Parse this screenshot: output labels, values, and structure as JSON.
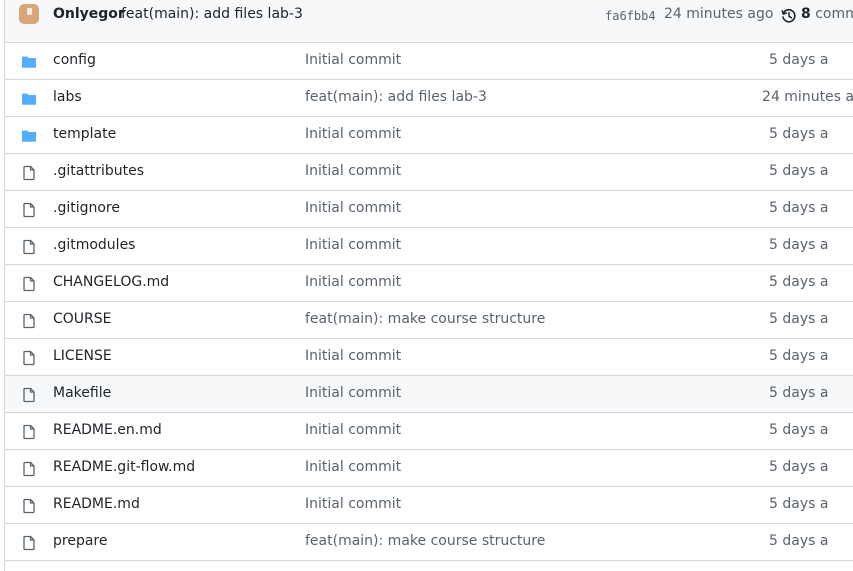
{
  "latest_commit": {
    "author": "Onlyegor",
    "message": "feat(main): add files lab-3",
    "sha": "fa6fbb4",
    "time": "24 minutes ago",
    "commits_count": "8",
    "commits_label": "comm"
  },
  "files": [
    {
      "name": "config",
      "type": "folder",
      "message": "Initial commit",
      "time": "5 days a"
    },
    {
      "name": "labs",
      "type": "folder",
      "message": "feat(main): add files lab-3",
      "time": "24 minutes a"
    },
    {
      "name": "template",
      "type": "folder",
      "message": "Initial commit",
      "time": "5 days a"
    },
    {
      "name": ".gitattributes",
      "type": "file",
      "message": "Initial commit",
      "time": "5 days a"
    },
    {
      "name": ".gitignore",
      "type": "file",
      "message": "Initial commit",
      "time": "5 days a"
    },
    {
      "name": ".gitmodules",
      "type": "file",
      "message": "Initial commit",
      "time": "5 days a"
    },
    {
      "name": "CHANGELOG.md",
      "type": "file",
      "message": "Initial commit",
      "time": "5 days a"
    },
    {
      "name": "COURSE",
      "type": "file",
      "message": "feat(main): make course structure",
      "time": "5 days a"
    },
    {
      "name": "LICENSE",
      "type": "file",
      "message": "Initial commit",
      "time": "5 days a"
    },
    {
      "name": "Makefile",
      "type": "file",
      "message": "Initial commit",
      "time": "5 days a"
    },
    {
      "name": "README.en.md",
      "type": "file",
      "message": "Initial commit",
      "time": "5 days a"
    },
    {
      "name": "README.git-flow.md",
      "type": "file",
      "message": "Initial commit",
      "time": "5 days a"
    },
    {
      "name": "README.md",
      "type": "file",
      "message": "Initial commit",
      "time": "5 days a"
    },
    {
      "name": "prepare",
      "type": "file",
      "message": "feat(main): make course structure",
      "time": "5 days a"
    }
  ],
  "colors": {
    "folder_icon": "#54aeff",
    "file_icon": "#59636e",
    "border": "#d0d7de",
    "header_bg": "#f6f8fa",
    "muted_text": "#59636e",
    "hover_row_bg": "#f6f8fa"
  },
  "icons": {
    "folder": "folder-icon",
    "file": "file-icon",
    "history": "history-icon",
    "avatar": "avatar"
  },
  "hovered_row": "Makefile"
}
